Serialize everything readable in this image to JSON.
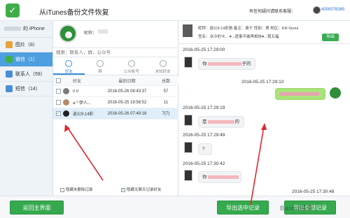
{
  "titlebar": {
    "title": "从iTunes备份文件恢复",
    "help": "有任何疑问请联系客服：",
    "user_id": "4000076365"
  },
  "sidebar": {
    "device_label": "的 iPhone",
    "items": [
      {
        "label": "图片（8）",
        "color": "#e9a13b"
      },
      {
        "label": "微信（1）",
        "color": "#3fae49"
      },
      {
        "label": "联系人（59）",
        "color": "#4a8fd6"
      },
      {
        "label": "短信（14）",
        "color": "#4a8fd6"
      }
    ]
  },
  "contact": {
    "nick_label": "昵称："
  },
  "search": {
    "placeholder": "搜索：联系人，群，公众号"
  },
  "tabs": [
    {
      "label": "好友"
    },
    {
      "label": "群"
    },
    {
      "label": "公众帐号"
    },
    {
      "label": "未知好友"
    }
  ],
  "table": {
    "headers": {
      "name": "好友",
      "date": "最后日期",
      "total": "总数"
    },
    "rows": [
      {
        "name": "0.0",
        "date": "2016-05-26 08:43:37",
        "total": "57",
        "checked": ""
      },
      {
        "name": "a * 伊人... ",
        "date": "2016-05-25 19:58:52",
        "total": "11",
        "checked": ""
      },
      {
        "name": "逍公9.14彩",
        "date": "2016-05-26 07:49:18",
        "total": "7(7)",
        "checked": "✓"
      }
    ]
  },
  "mid_footer": {
    "hide_deleted": "隐藏未删除记录",
    "hide_empty": "隐藏无聊天记录好友",
    "hide_empty_check": "✓"
  },
  "chat": {
    "header_line1": "昵称：逍公9.14彩驰   备注：奋于   性别：男   地区：KR-Seoul",
    "header_line2": "签名：冰冷的卡... ♥...遗事不敢再相信♥...我五福",
    "export_one": "导出",
    "messages": [
      {
        "ts": "2016-05-25 17:29:00",
        "text_pre": "你",
        "text_post": "子的"
      },
      {
        "ts": "2016-05-25 17:29:10",
        "text_pre": "",
        "text_post": ""
      },
      {
        "ts": "2016-05-25 17:29:19",
        "text_pre": "是",
        "text_post": "的"
      },
      {
        "ts": "2016-05-25 17:29:49",
        "text_pre": "?",
        "text_post": ""
      },
      {
        "ts": "2016-05-25 17:30:42",
        "text_pre": "你",
        "text_post": ""
      },
      {
        "ts": "2016-05-25 17:30:48",
        "text_pre": "",
        "text_post": ""
      }
    ]
  },
  "buttons": {
    "back": "返回主界面",
    "export_selected": "导出选中记录",
    "export_all": "导出全部记录"
  },
  "watermark": "Baidu经验"
}
